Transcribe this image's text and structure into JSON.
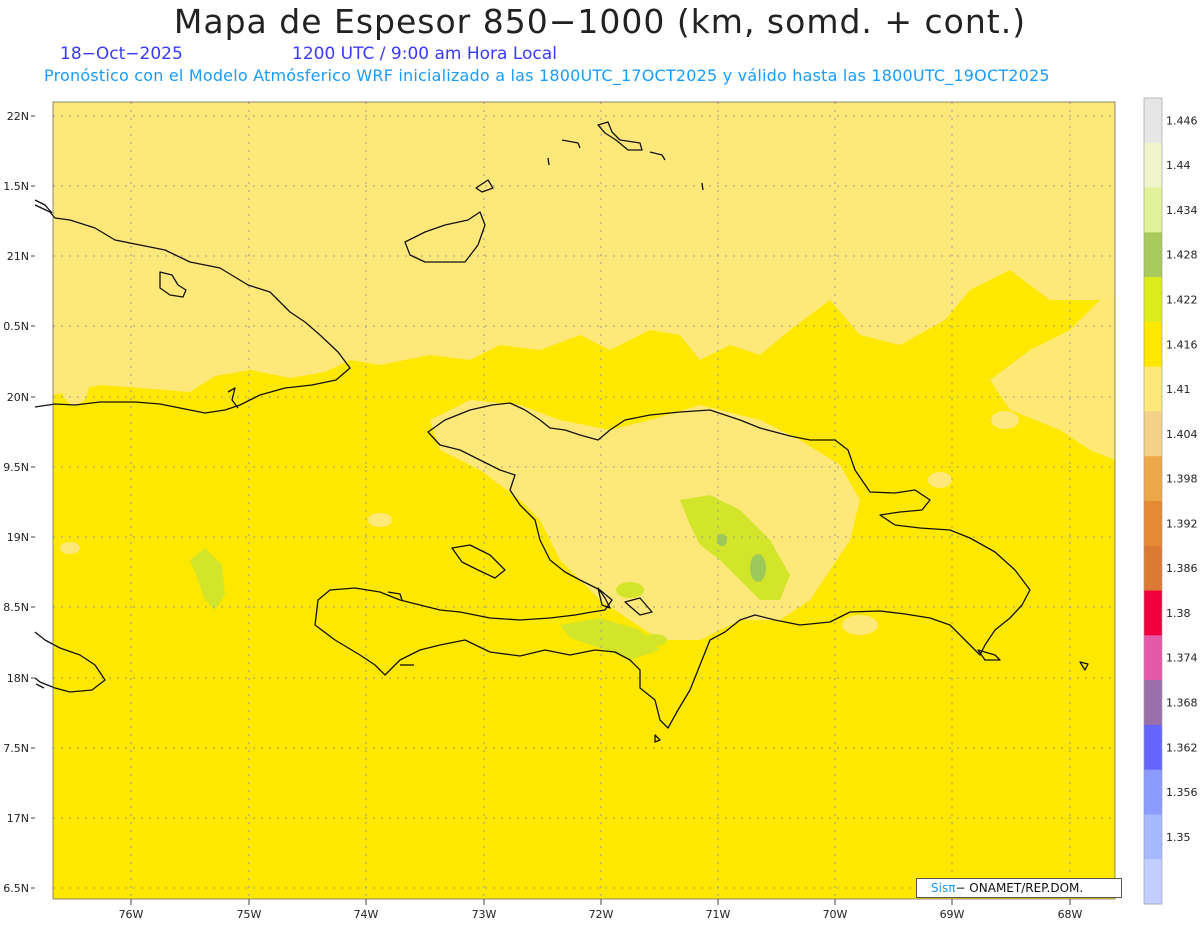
{
  "header": {
    "title": "Mapa de Espesor 850−1000 (km, somd. + cont.)",
    "date": "18−Oct−2025",
    "time": "1200 UTC / 9:00 am Hora Local",
    "forecast": "Pronóstico con el Modelo Atmósferico WRF inicializado a las 1800UTC_17OCT2025 y válido hasta las  1800UTC_19OCT2025"
  },
  "credit": {
    "brand": "Sisπ",
    "org": "− ONAMET/REP.DOM."
  },
  "colors": {
    "base": "#ffe800",
    "light": "#ffe87a",
    "green": "#d2e52a",
    "dark_green": "#9dc85a",
    "coast": "#111111",
    "grid": "#9a9a9a"
  },
  "map": {
    "lon_labels": [
      "76W",
      "75W",
      "74W",
      "73W",
      "72W",
      "71W",
      "70W",
      "69W",
      "68W"
    ],
    "lat_labels": [
      "22N",
      "1.5N",
      "21N",
      "0.5N",
      "20N",
      "9.5N",
      "19N",
      "8.5N",
      "18N",
      "7.5N",
      "17N",
      "6.5N"
    ]
  },
  "legend": {
    "labels": [
      "1.446",
      "1.44",
      "1.434",
      "1.428",
      "1.422",
      "1.416",
      "1.41",
      "1.404",
      "1.398",
      "1.392",
      "1.386",
      "1.38",
      "1.374",
      "1.368",
      "1.362",
      "1.356",
      "1.35"
    ],
    "colors": [
      "#e6e6e6",
      "#f0f5cc",
      "#e2f29a",
      "#a9cb5e",
      "#dded1c",
      "#ffe800",
      "#ffe87a",
      "#f4d188",
      "#eda848",
      "#e48a34",
      "#dc7a34",
      "#f0003c",
      "#e45aa8",
      "#9a70aa",
      "#6464ff",
      "#8c9bff",
      "#a6b8ff",
      "#c2ceff"
    ]
  }
}
